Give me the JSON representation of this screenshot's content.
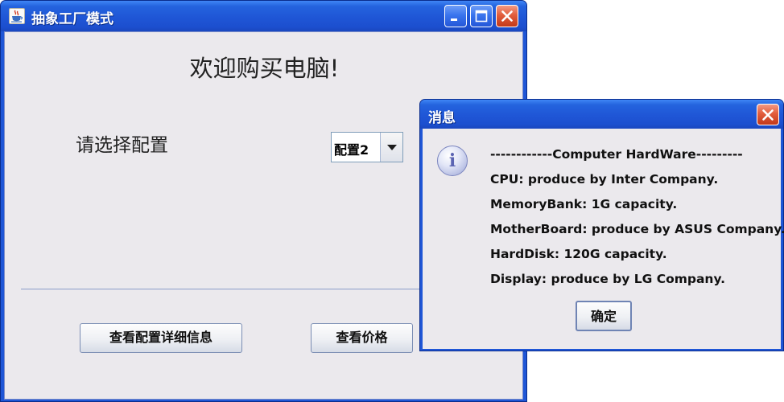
{
  "main_window": {
    "title": "抽象工厂模式",
    "heading": "欢迎购买电脑!",
    "config_label": "请选择配置",
    "config_select": {
      "value": "配置2"
    },
    "details_button": "查看配置详细信息",
    "price_button": "查看价格",
    "title_buttons": [
      "minimize-icon",
      "maximize-icon",
      "close-icon"
    ]
  },
  "dialog": {
    "title": "消息",
    "icon": "info-icon",
    "icon_glyph": "i",
    "lines": [
      "------------Computer HardWare---------",
      "CPU: produce by Inter Company.",
      "MemoryBank: 1G capacity.",
      "MotherBoard: produce by ASUS Company.",
      "HardDisk: 120G capacity.",
      "Display: produce by LG Company."
    ],
    "ok_button": "确定"
  },
  "colors": {
    "titlebar": "#1f56d6",
    "window_bg": "#ebe9ed",
    "close_button": "#e25d3c",
    "separator": "#8a9cc9"
  }
}
